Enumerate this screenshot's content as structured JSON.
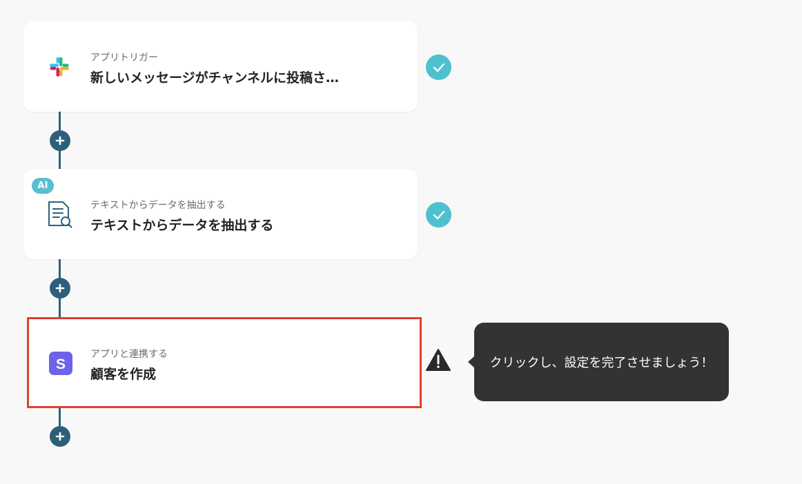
{
  "colors": {
    "connector": "#2e5f7a",
    "check": "#4fc0cf",
    "highlight": "#e0412a",
    "tooltip_bg": "#333333",
    "ai_badge": "#56c0d0",
    "stripe": "#6c63e8"
  },
  "steps": [
    {
      "icon": "slack-icon",
      "subtitle": "アプリトリガー",
      "title": "新しいメッセージがチャンネルに投稿さ…",
      "status": "completed"
    },
    {
      "icon": "document-search-icon",
      "badge": "AI",
      "subtitle": "テキストからデータを抽出する",
      "title": "テキストからデータを抽出する",
      "status": "completed"
    },
    {
      "icon": "stripe-icon",
      "icon_letter": "S",
      "subtitle": "アプリと連携する",
      "title": "顧客を作成",
      "status": "incomplete"
    }
  ],
  "tooltip": {
    "text": "クリックし、設定を完了させましょう！"
  }
}
